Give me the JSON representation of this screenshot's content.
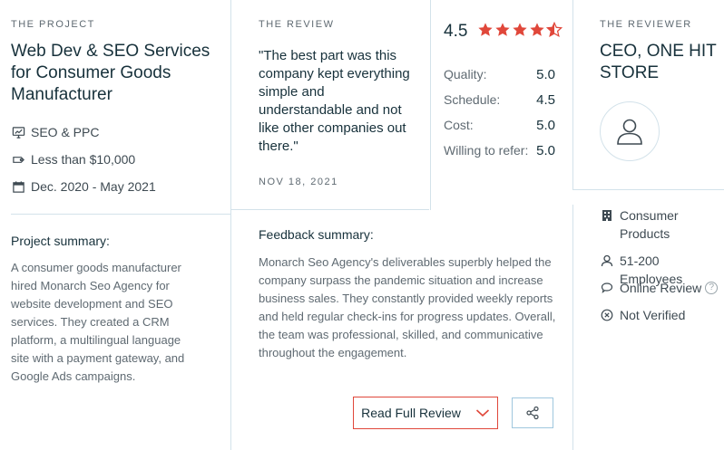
{
  "project": {
    "eyebrow": "THE PROJECT",
    "title": "Web Dev & SEO Services for Consumer Goods Manufacturer",
    "service": "SEO & PPC",
    "budget": "Less than $10,000",
    "dates": "Dec. 2020 - May 2021",
    "summary_label": "Project summary:",
    "summary": "A consumer goods manufacturer hired Monarch Seo Agency for website development and SEO services. They created a CRM platform, a multilingual language site with a payment gateway, and Google Ads campaigns."
  },
  "review": {
    "eyebrow": "THE REVIEW",
    "quote": "\"The best part was this company kept everything simple and understandable and not like other companies out there.\"",
    "date": "NOV 18, 2021",
    "overall": "4.5",
    "overall_stars": 4.5,
    "scores": [
      {
        "label": "Quality:",
        "value": "5.0"
      },
      {
        "label": "Schedule:",
        "value": "4.5"
      },
      {
        "label": "Cost:",
        "value": "5.0"
      },
      {
        "label": "Willing to refer:",
        "value": "5.0"
      }
    ],
    "feedback_label": "Feedback summary:",
    "feedback": "Monarch Seo Agency's deliverables superbly helped the company surpass the pandemic situation and increase business sales. They constantly provided weekly reports and held regular check-ins for progress updates. Overall, the team was professional, skilled, and communicative throughout the engagement.",
    "read_full_label": "Read Full Review"
  },
  "reviewer": {
    "eyebrow": "THE REVIEWER",
    "title": "CEO, One Hit Store",
    "industry": "Consumer Products",
    "size": "51-200 Employees",
    "review_type": "Online Review",
    "verification": "Not Verified"
  },
  "colors": {
    "accent_red": "#e0473a",
    "border": "#d3e2ea",
    "share_border": "#9fc7de"
  },
  "icons": {
    "service": "monitor-chart-icon",
    "budget": "price-tag-icon",
    "dates": "calendar-icon",
    "industry": "building-icon",
    "size": "user-icon",
    "review_type": "chat-bubble-icon",
    "verification": "x-circle-icon",
    "share": "share-icon",
    "chevron": "chevron-down-icon"
  }
}
